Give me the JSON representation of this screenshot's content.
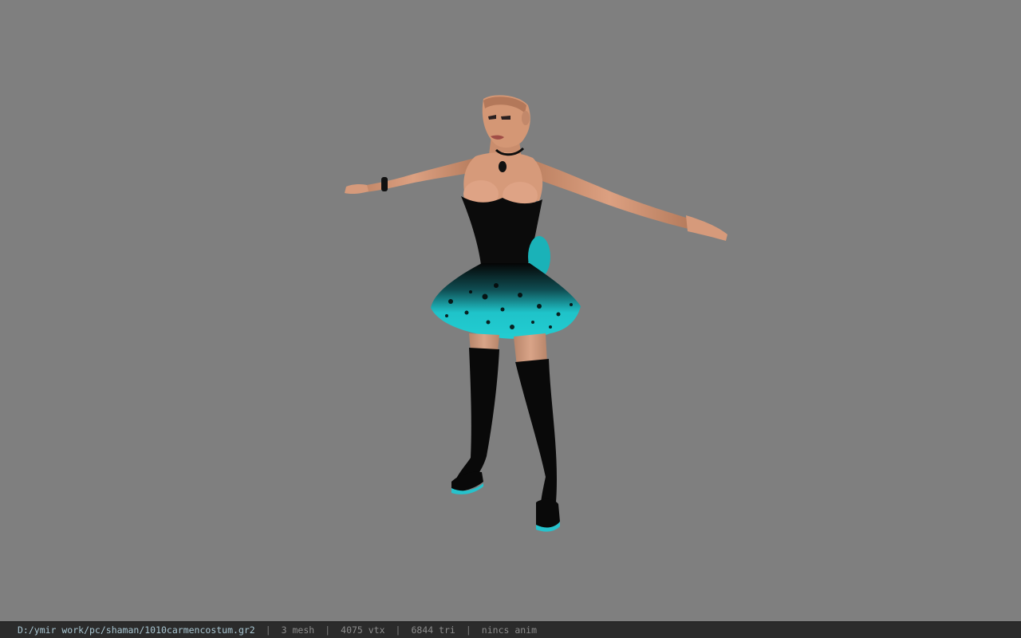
{
  "viewport": {
    "background": "#7f7f7f",
    "model": {
      "skin_color": "#d69a76",
      "dress_color": "#0a0a0a",
      "skirt_color": "#1fc3c9",
      "boots_color": "#080808",
      "boot_sole_color": "#26c2cc"
    }
  },
  "status_bar": {
    "file_path": "D:/ymir work/pc/shaman/1010carmencostum.gr2",
    "separator": "|",
    "mesh_count": "3 mesh",
    "vertex_count": "4075 vtx",
    "triangle_count": "6844 tri",
    "anim_status": "nincs anim"
  }
}
